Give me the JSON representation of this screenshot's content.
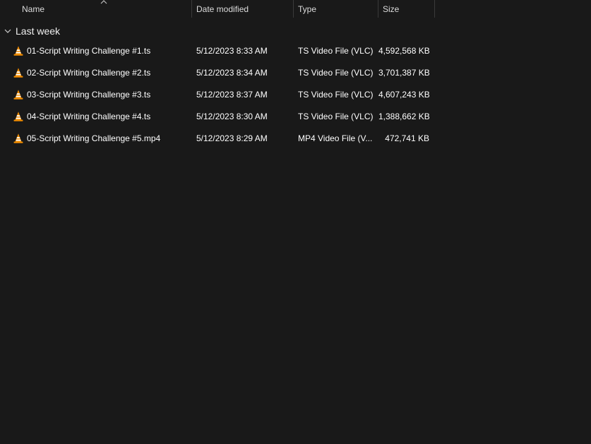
{
  "columns": {
    "name": "Name",
    "date": "Date modified",
    "type": "Type",
    "size": "Size"
  },
  "group": {
    "label": "Last week"
  },
  "files": [
    {
      "name": "01-Script Writing Challenge #1.ts",
      "date": "5/12/2023 8:33 AM",
      "type": "TS Video File (VLC)",
      "size": "4,592,568 KB",
      "icon": "vlc-icon"
    },
    {
      "name": "02-Script Writing Challenge #2.ts",
      "date": "5/12/2023 8:34 AM",
      "type": "TS Video File (VLC)",
      "size": "3,701,387 KB",
      "icon": "vlc-icon"
    },
    {
      "name": "03-Script Writing Challenge #3.ts",
      "date": "5/12/2023 8:37 AM",
      "type": "TS Video File (VLC)",
      "size": "4,607,243 KB",
      "icon": "vlc-icon"
    },
    {
      "name": "04-Script Writing Challenge #4.ts",
      "date": "5/12/2023 8:30 AM",
      "type": "TS Video File (VLC)",
      "size": "1,388,662 KB",
      "icon": "vlc-icon"
    },
    {
      "name": "05-Script Writing Challenge #5.mp4",
      "date": "5/12/2023 8:29 AM",
      "type": "MP4 Video File (V...",
      "size": "472,741 KB",
      "icon": "vlc-icon"
    }
  ],
  "colors": {
    "background": "#191919",
    "text": "#ffffff",
    "header_text": "#dcdcdc",
    "separator": "#3a3a3a",
    "vlc_orange": "#f08c00"
  }
}
